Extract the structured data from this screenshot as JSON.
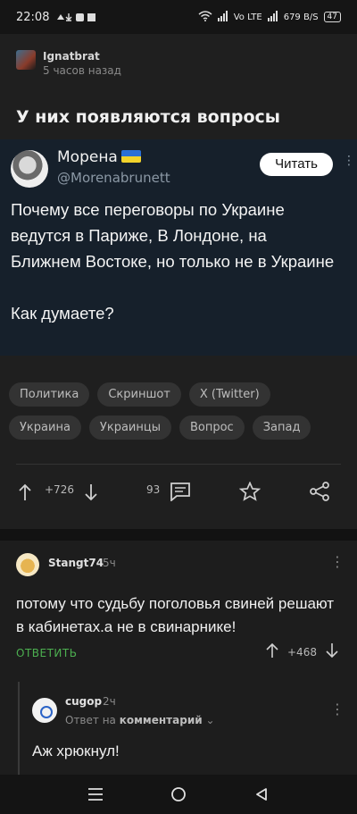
{
  "status_bar": {
    "time": "22:08",
    "network": "Vo LTE",
    "speed": "679 B/S",
    "battery": "47"
  },
  "post": {
    "author": "Ignatbrat",
    "time": "5 часов назад",
    "title": "У них появляются вопросы",
    "tweet": {
      "name": "Морена",
      "handle": "@Morenabrunett",
      "follow_label": "Читать",
      "text": "Почему все переговоры по Украине ведутся в Париже, В Лондоне, на Ближнем Востоке, но только не в Украине\n\nКак думаете?"
    },
    "tags": [
      "Политика",
      "Скриншот",
      "X (Twitter)",
      "Украина",
      "Украинцы",
      "Вопрос",
      "Запад"
    ],
    "rating": "+726",
    "comments_count": "93"
  },
  "comment": {
    "author": "Stangt74",
    "time": "5ч",
    "text": "потому что судьбу поголовья свиней решают в кабинетах.а не в свинарнике!",
    "reply_label": "ОТВЕТИТЬ",
    "rating": "+468"
  },
  "reply": {
    "author": "cugop",
    "time": "2ч",
    "sub_prefix": "Ответ на",
    "sub_target": "комментарий",
    "text": "Аж хрюкнул!"
  },
  "colors": {
    "accent_green": "#4caf50",
    "tweet_bg": "#16202b"
  }
}
